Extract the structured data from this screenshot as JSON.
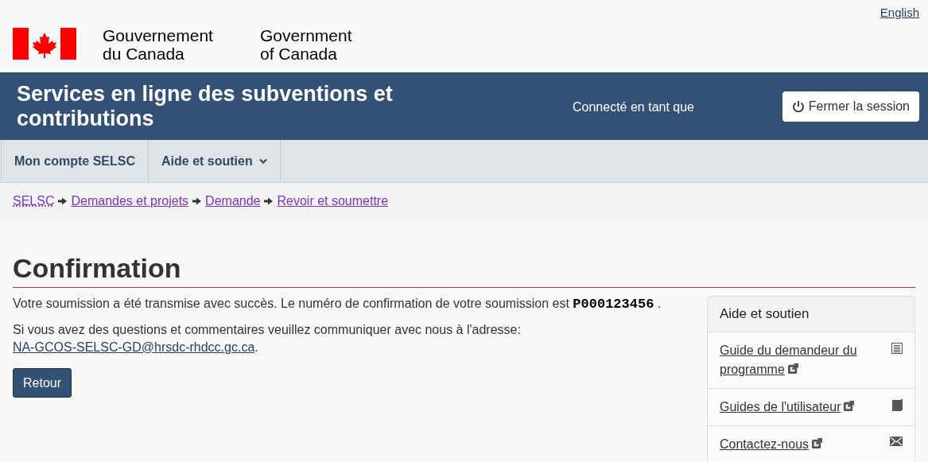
{
  "language_link": "English",
  "signature": {
    "french": [
      "Gouvernement",
      "du Canada"
    ],
    "english": [
      "Government",
      "of Canada"
    ]
  },
  "app_bar": {
    "title": "Services en ligne des subventions et contributions",
    "user_label": "Connecté en tant que",
    "logout_button": "Fermer la session"
  },
  "menu": [
    {
      "label": "Mon compte SELSC",
      "has_dropdown": false
    },
    {
      "label": "Aide et soutien",
      "has_dropdown": true
    }
  ],
  "breadcrumbs": [
    "SELSC",
    "Demandes et projets",
    "Demande",
    "Revoir et soumettre"
  ],
  "page": {
    "title": "Confirmation",
    "message": "Votre soumission a été transmise avec succès. Le numéro de confirmation de votre soumission est **P000123456** .",
    "contact_text": "Si vous avez des questions et commentaires veuillez communiquer avec nous à l'adresse:",
    "contact_email": "NA-GCOS-SELSC-GD@hrsdc-rhdcc.gc.ca",
    "contact_end": ".",
    "back_button": "Retour"
  },
  "help_panel": {
    "title": "Aide et soutien",
    "links": [
      {
        "label": "Guide du demandeur du programme"
      },
      {
        "label": "Guides de l'utilisateur"
      },
      {
        "label": "Contactez-nous"
      }
    ]
  }
}
